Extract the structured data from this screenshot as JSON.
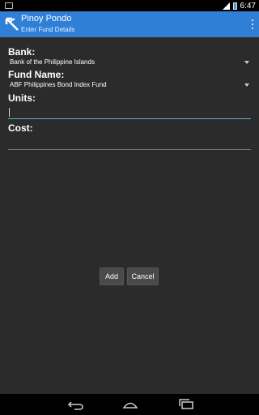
{
  "status": {
    "time": "6:47"
  },
  "app": {
    "title": "Pinoy Pondo",
    "subtitle": "Enter Fund Details"
  },
  "form": {
    "bank_label": "Bank:",
    "bank_value": "Bank of the Philippine Islands",
    "fund_label": "Fund Name:",
    "fund_value": "ABF Philippines Bond Index Fund",
    "units_label": "Units:",
    "units_value": "",
    "cost_label": "Cost:",
    "cost_value": ""
  },
  "buttons": {
    "add": "Add",
    "cancel": "Cancel"
  },
  "colors": {
    "appbar": "#2f7fd6",
    "accent": "#5ab4c8",
    "background": "#2b2b2b"
  }
}
